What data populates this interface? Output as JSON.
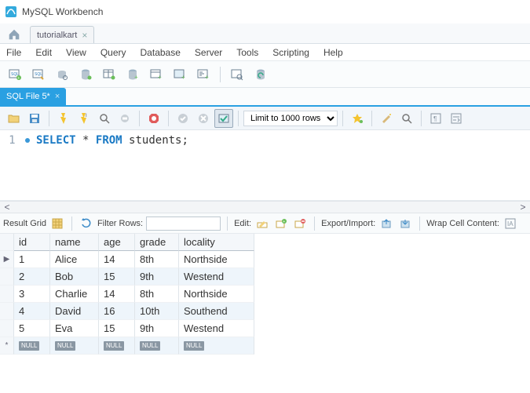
{
  "title": "MySQL Workbench",
  "connection_tab": "tutorialkart",
  "menu": [
    "File",
    "Edit",
    "View",
    "Query",
    "Database",
    "Server",
    "Tools",
    "Scripting",
    "Help"
  ],
  "sql_tab": "SQL File 5*",
  "limit_label": "Limit to 1000 rows",
  "editor": {
    "line_number": "1",
    "tokens": {
      "kw1": "SELECT",
      "star": "*",
      "kw2": "FROM",
      "ident": "students",
      "semi": ";"
    }
  },
  "resultbar": {
    "result_grid": "Result Grid",
    "filter_rows": "Filter Rows:",
    "edit": "Edit:",
    "export_import": "Export/Import:",
    "wrap_cell": "Wrap Cell Content:"
  },
  "grid": {
    "columns": [
      "id",
      "name",
      "age",
      "grade",
      "locality"
    ],
    "rows": [
      [
        "1",
        "Alice",
        "14",
        "8th",
        "Northside"
      ],
      [
        "2",
        "Bob",
        "15",
        "9th",
        "Westend"
      ],
      [
        "3",
        "Charlie",
        "14",
        "8th",
        "Northside"
      ],
      [
        "4",
        "David",
        "16",
        "10th",
        "Southend"
      ],
      [
        "5",
        "Eva",
        "15",
        "9th",
        "Westend"
      ]
    ],
    "null_label": "NULL"
  },
  "chart_data": {
    "type": "table",
    "columns": [
      "id",
      "name",
      "age",
      "grade",
      "locality"
    ],
    "rows": [
      {
        "id": 1,
        "name": "Alice",
        "age": 14,
        "grade": "8th",
        "locality": "Northside"
      },
      {
        "id": 2,
        "name": "Bob",
        "age": 15,
        "grade": "9th",
        "locality": "Westend"
      },
      {
        "id": 3,
        "name": "Charlie",
        "age": 14,
        "grade": "8th",
        "locality": "Northside"
      },
      {
        "id": 4,
        "name": "David",
        "age": 16,
        "grade": "10th",
        "locality": "Southend"
      },
      {
        "id": 5,
        "name": "Eva",
        "age": 15,
        "grade": "9th",
        "locality": "Westend"
      }
    ]
  }
}
